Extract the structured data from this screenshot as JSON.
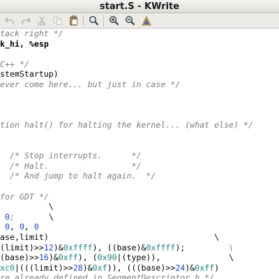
{
  "window": {
    "title": "start.S - KWrite"
  },
  "toolbar": {
    "buttons": [
      {
        "name": "undo-button",
        "icon": "undo-icon"
      },
      {
        "name": "redo-button",
        "icon": "redo-icon"
      },
      {
        "name": "cut-button",
        "icon": "cut-icon"
      },
      {
        "name": "copy-button",
        "icon": "copy-icon"
      },
      {
        "name": "paste-button",
        "icon": "paste-icon"
      },
      {
        "name": "find-button",
        "icon": "magnifier-icon"
      },
      {
        "name": "zoom-in-button",
        "icon": "zoom-in-icon"
      },
      {
        "name": "zoom-out-button",
        "icon": "zoom-out-icon"
      },
      {
        "name": "spellcheck-button",
        "icon": "spellcheck-icon"
      }
    ]
  },
  "colors": {
    "comment": "#7b7b7b",
    "number": "#1f45c4",
    "hex": "#1f8080",
    "text": "#000000"
  },
  "editor": {
    "lines": [
      [
        {
          "t": "tack right */",
          "c": "cmt"
        }
      ],
      [
        {
          "t": "k_hi, %esp",
          "c": "kw"
        }
      ],
      [
        {
          "t": "",
          "c": "txt"
        }
      ],
      [
        {
          "t": "C++ */",
          "c": "cmt"
        }
      ],
      [
        {
          "t": "stemStartup)",
          "c": "txt"
        }
      ],
      [
        {
          "t": "ever come here... but just in case */",
          "c": "cmt"
        }
      ],
      [
        {
          "t": "",
          "c": "txt"
        }
      ],
      [
        {
          "t": "",
          "c": "txt"
        }
      ],
      [
        {
          "t": "",
          "c": "txt"
        }
      ],
      [
        {
          "t": "tion halt() for halting the kernel... (what else) */",
          "c": "cmt"
        }
      ],
      [
        {
          "t": "",
          "c": "txt"
        }
      ],
      [
        {
          "t": "",
          "c": "txt"
        }
      ],
      [
        {
          "t": "  /* Stop interrupts.      */",
          "c": "cmt"
        }
      ],
      [
        {
          "t": "  /* Halt.                 */",
          "c": "cmt"
        }
      ],
      [
        {
          "t": "  /* And jump to halt again.  */",
          "c": "cmt"
        }
      ],
      [
        {
          "t": "",
          "c": "txt"
        }
      ],
      [
        {
          "t": "for GDT */",
          "c": "cmt"
        }
      ],
      [
        {
          "t": "          \\",
          "c": "txt"
        }
      ],
      [
        {
          "t": " 0",
          "c": "num"
        },
        {
          "t": ";       ",
          "c": "cmt"
        },
        {
          "t": "\\",
          "c": "txt"
        }
      ],
      [
        {
          "t": " 0",
          "c": "num"
        },
        {
          "t": ", ",
          "c": "txt"
        },
        {
          "t": "0",
          "c": "num"
        },
        {
          "t": ", ",
          "c": "txt"
        },
        {
          "t": "0",
          "c": "num"
        }
      ],
      [
        {
          "t": "ase,limit)                                  \\",
          "c": "txt"
        }
      ],
      [
        {
          "t": "(limit)>>",
          "c": "txt"
        },
        {
          "t": "12",
          "c": "num"
        },
        {
          "t": ")&",
          "c": "txt"
        },
        {
          "t": "0xffff",
          "c": "hex"
        },
        {
          "t": "), ((base)&",
          "c": "txt"
        },
        {
          "t": "0xffff",
          "c": "hex"
        },
        {
          "t": ");",
          "c": "txt"
        },
        {
          "t": "         \\",
          "c": "cmt"
        }
      ],
      [
        {
          "t": "(base)>>",
          "c": "txt"
        },
        {
          "t": "16",
          "c": "num"
        },
        {
          "t": ")&",
          "c": "txt"
        },
        {
          "t": "0xff",
          "c": "hex"
        },
        {
          "t": "), (",
          "c": "txt"
        },
        {
          "t": "0x90",
          "c": "hex"
        },
        {
          "t": "|(type)),              \\",
          "c": "txt"
        }
      ],
      [
        {
          "t": "xc0",
          "c": "hex"
        },
        {
          "t": "|(((limit)>>",
          "c": "txt"
        },
        {
          "t": "28",
          "c": "num"
        },
        {
          "t": ")&",
          "c": "txt"
        },
        {
          "t": "0xf",
          "c": "hex"
        },
        {
          "t": ")), (((base)>>",
          "c": "txt"
        },
        {
          "t": "24",
          "c": "num"
        },
        {
          "t": ")&",
          "c": "txt"
        },
        {
          "t": "0xff",
          "c": "hex"
        },
        {
          "t": ")",
          "c": "txt"
        }
      ],
      [
        {
          "t": "re already defined in SegmentDescriptor.h */",
          "c": "cmt"
        }
      ]
    ]
  }
}
